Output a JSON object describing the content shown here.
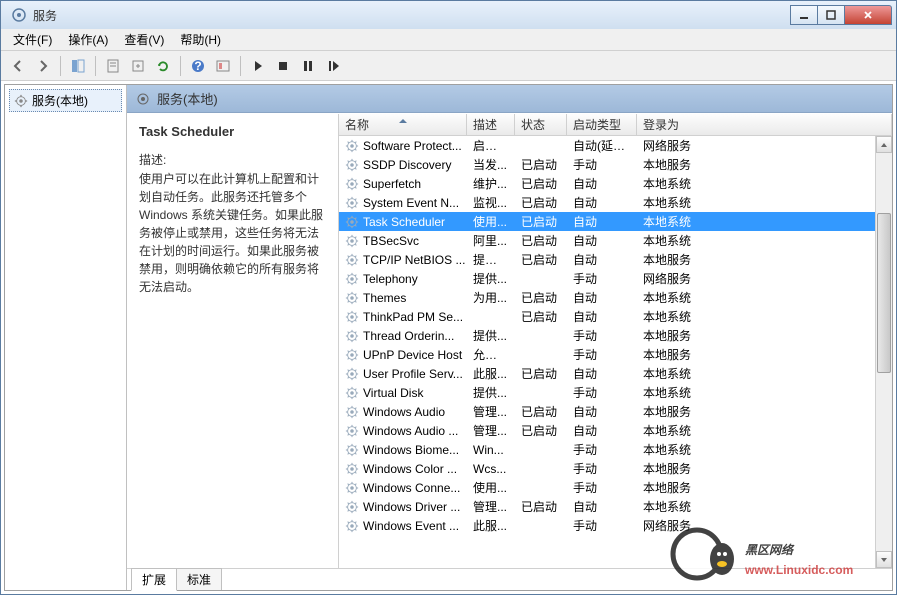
{
  "window": {
    "title": "服务"
  },
  "menu": {
    "file": "文件(F)",
    "action": "操作(A)",
    "view": "查看(V)",
    "help": "帮助(H)"
  },
  "left_tree": {
    "root": "服务(本地)"
  },
  "right_header": {
    "label": "服务(本地)"
  },
  "detail": {
    "title": "Task Scheduler",
    "desc_label": "描述:",
    "desc": "使用户可以在此计算机上配置和计划自动任务。此服务还托管多个 Windows 系统关键任务。如果此服务被停止或禁用，这些任务将无法在计划的时间运行。如果此服务被禁用，则明确依赖它的所有服务将无法启动。"
  },
  "columns": {
    "name": "名称",
    "desc": "描述",
    "status": "状态",
    "startup": "启动类型",
    "logon": "登录为"
  },
  "services": [
    {
      "name": "Software Protect...",
      "desc": "启用 ...",
      "status": "",
      "startup": "自动(延迟...",
      "logon": "网络服务",
      "selected": false
    },
    {
      "name": "SSDP Discovery",
      "desc": "当发...",
      "status": "已启动",
      "startup": "手动",
      "logon": "本地服务",
      "selected": false
    },
    {
      "name": "Superfetch",
      "desc": "维护...",
      "status": "已启动",
      "startup": "自动",
      "logon": "本地系统",
      "selected": false
    },
    {
      "name": "System Event N...",
      "desc": "监视...",
      "status": "已启动",
      "startup": "自动",
      "logon": "本地系统",
      "selected": false
    },
    {
      "name": "Task Scheduler",
      "desc": "使用...",
      "status": "已启动",
      "startup": "自动",
      "logon": "本地系统",
      "selected": true
    },
    {
      "name": "TBSecSvc",
      "desc": "阿里...",
      "status": "已启动",
      "startup": "自动",
      "logon": "本地系统",
      "selected": false
    },
    {
      "name": "TCP/IP NetBIOS ...",
      "desc": "提供 ...",
      "status": "已启动",
      "startup": "自动",
      "logon": "本地服务",
      "selected": false
    },
    {
      "name": "Telephony",
      "desc": "提供...",
      "status": "",
      "startup": "手动",
      "logon": "网络服务",
      "selected": false
    },
    {
      "name": "Themes",
      "desc": "为用...",
      "status": "已启动",
      "startup": "自动",
      "logon": "本地系统",
      "selected": false
    },
    {
      "name": "ThinkPad PM Se...",
      "desc": "",
      "status": "已启动",
      "startup": "自动",
      "logon": "本地系统",
      "selected": false
    },
    {
      "name": "Thread Orderin...",
      "desc": "提供...",
      "status": "",
      "startup": "手动",
      "logon": "本地服务",
      "selected": false
    },
    {
      "name": "UPnP Device Host",
      "desc": "允许 ...",
      "status": "",
      "startup": "手动",
      "logon": "本地服务",
      "selected": false
    },
    {
      "name": "User Profile Serv...",
      "desc": "此服...",
      "status": "已启动",
      "startup": "自动",
      "logon": "本地系统",
      "selected": false
    },
    {
      "name": "Virtual Disk",
      "desc": "提供...",
      "status": "",
      "startup": "手动",
      "logon": "本地系统",
      "selected": false
    },
    {
      "name": "Windows Audio",
      "desc": "管理...",
      "status": "已启动",
      "startup": "自动",
      "logon": "本地服务",
      "selected": false
    },
    {
      "name": "Windows Audio ...",
      "desc": "管理...",
      "status": "已启动",
      "startup": "自动",
      "logon": "本地系统",
      "selected": false
    },
    {
      "name": "Windows Biome...",
      "desc": "Win...",
      "status": "",
      "startup": "手动",
      "logon": "本地系统",
      "selected": false
    },
    {
      "name": "Windows Color ...",
      "desc": "Wcs...",
      "status": "",
      "startup": "手动",
      "logon": "本地服务",
      "selected": false
    },
    {
      "name": "Windows Conne...",
      "desc": "使用...",
      "status": "",
      "startup": "手动",
      "logon": "本地服务",
      "selected": false
    },
    {
      "name": "Windows Driver ...",
      "desc": "管理...",
      "status": "已启动",
      "startup": "自动",
      "logon": "本地系统",
      "selected": false
    },
    {
      "name": "Windows Event ...",
      "desc": "此服...",
      "status": "",
      "startup": "手动",
      "logon": "网络服务",
      "selected": false
    }
  ],
  "tabs": {
    "extended": "扩展",
    "standard": "标准"
  },
  "watermark": {
    "line1": "黑区网络",
    "line2": "www.Linuxidc.com"
  }
}
